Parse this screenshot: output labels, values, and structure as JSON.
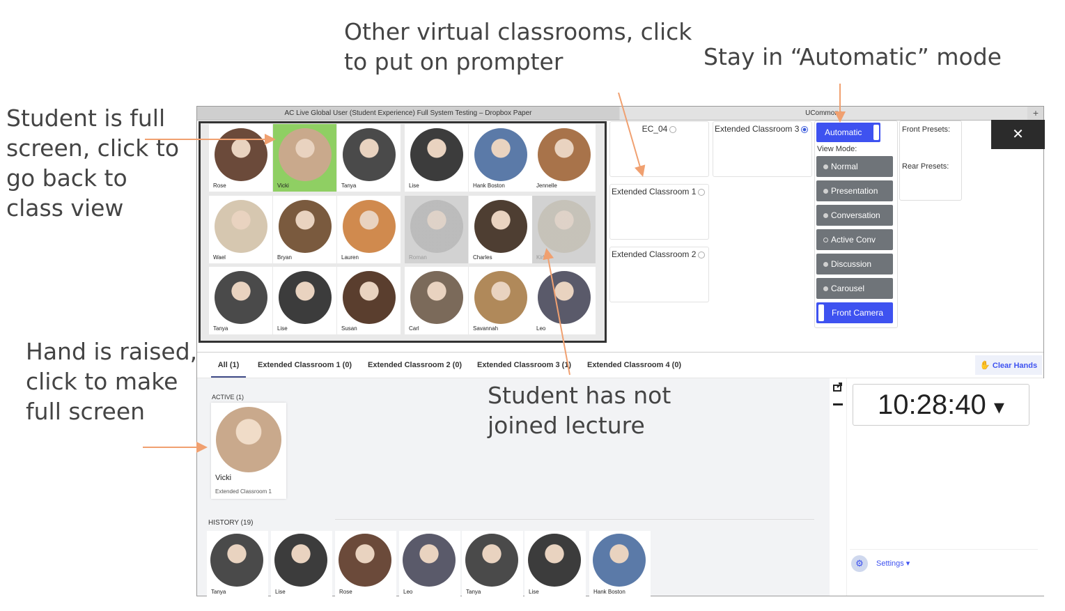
{
  "annotations": {
    "other_rooms": [
      "Other virtual classrooms, click",
      "to put on prompter"
    ],
    "automatic": "Stay in “Automatic” mode",
    "full_screen": [
      "Student is full",
      "screen, click to",
      "go back to",
      "class view"
    ],
    "hand_raised": [
      "Hand is raised,",
      "click to make",
      "full screen"
    ],
    "not_joined": [
      "Student has not",
      "joined lecture"
    ]
  },
  "browser": {
    "tab1": "AC Live Global User (Student Experience) Full System Testing – Dropbox Paper",
    "tab2": "UCommons",
    "new_tab": "+"
  },
  "grid": {
    "rows": [
      [
        {
          "name": "Rose",
          "color": "#6b4a3a"
        },
        {
          "name": "Vicki",
          "color": "#c9a98c",
          "highlight": true
        },
        {
          "name": "Tanya",
          "color": "#4a4a4a"
        },
        {
          "name": "Lise",
          "color": "#3c3c3c"
        },
        {
          "name": "Hank Boston",
          "color": "#5b7aa8"
        },
        {
          "name": "Jennelle",
          "color": "#a8734a"
        }
      ],
      [
        {
          "name": "Wael",
          "color": "#d6c7b0"
        },
        {
          "name": "Bryan",
          "color": "#7a5a3e"
        },
        {
          "name": "Lauren",
          "color": "#d08a4e"
        },
        {
          "name": "Roman",
          "color": "#a9a9a9",
          "dim": true
        },
        {
          "name": "Charles",
          "color": "#4e3e32"
        },
        {
          "name": "Kirk",
          "color": "#bdb6a5",
          "dim": true
        }
      ],
      [
        {
          "name": "Tanya",
          "color": "#4a4a4a"
        },
        {
          "name": "Lise",
          "color": "#3c3c3c"
        },
        {
          "name": "Susan",
          "color": "#5a3e2e"
        },
        {
          "name": "Carl",
          "color": "#7b6a5a"
        },
        {
          "name": "Savannah",
          "color": "#b0895a"
        },
        {
          "name": "Leo",
          "color": "#5a5a6a"
        }
      ]
    ]
  },
  "rooms": {
    "ec04": "EC_04",
    "ext3": "Extended Classroom 3",
    "ext1": "Extended Classroom 1",
    "ext2": "Extended Classroom 2"
  },
  "modes": {
    "automatic": "Automatic",
    "view_mode_label": "View Mode:",
    "normal": "Normal",
    "presentation": "Presentation",
    "conversation": "Conversation",
    "active_conv": "Active Conv",
    "discussion": "Discussion",
    "carousel": "Carousel",
    "front_camera": "Front Camera"
  },
  "presets": {
    "front": "Front Presets:",
    "rear": "Rear Presets:"
  },
  "close": "✕",
  "tabs": {
    "all": "All (1)",
    "ec1": "Extended Classroom 1 (0)",
    "ec2": "Extended Classroom 2 (0)",
    "ec3": "Extended Classroom 3 (1)",
    "ec4": "Extended Classroom 4 (0)",
    "clear_hands": "Clear Hands"
  },
  "active": {
    "label": "ACTIVE (1)",
    "name": "Vicki",
    "room": "Extended Classroom 1",
    "color": "#c9a98c"
  },
  "history": {
    "label": "HISTORY (19)",
    "items": [
      {
        "name": "Tanya",
        "color": "#4a4a4a"
      },
      {
        "name": "Lise",
        "color": "#3c3c3c"
      },
      {
        "name": "Rose",
        "color": "#6b4a3a"
      },
      {
        "name": "Leo",
        "color": "#5a5a6a"
      },
      {
        "name": "Tanya",
        "color": "#4a4a4a"
      },
      {
        "name": "Lise",
        "color": "#3c3c3c"
      },
      {
        "name": "Hank Boston",
        "color": "#5b7aa8"
      }
    ]
  },
  "clock": {
    "time": "10:28:40",
    "caret": "▾"
  },
  "settings": "Settings ▾",
  "icons": {
    "share": "share-icon",
    "minus": "minus-icon",
    "hand": "hand-icon",
    "gear": "gear-icon"
  },
  "colors": {
    "accent": "#3e52f0",
    "arrow": "#f0a070",
    "highlight": "#8fcf63",
    "mode_button": "#6f7479"
  }
}
